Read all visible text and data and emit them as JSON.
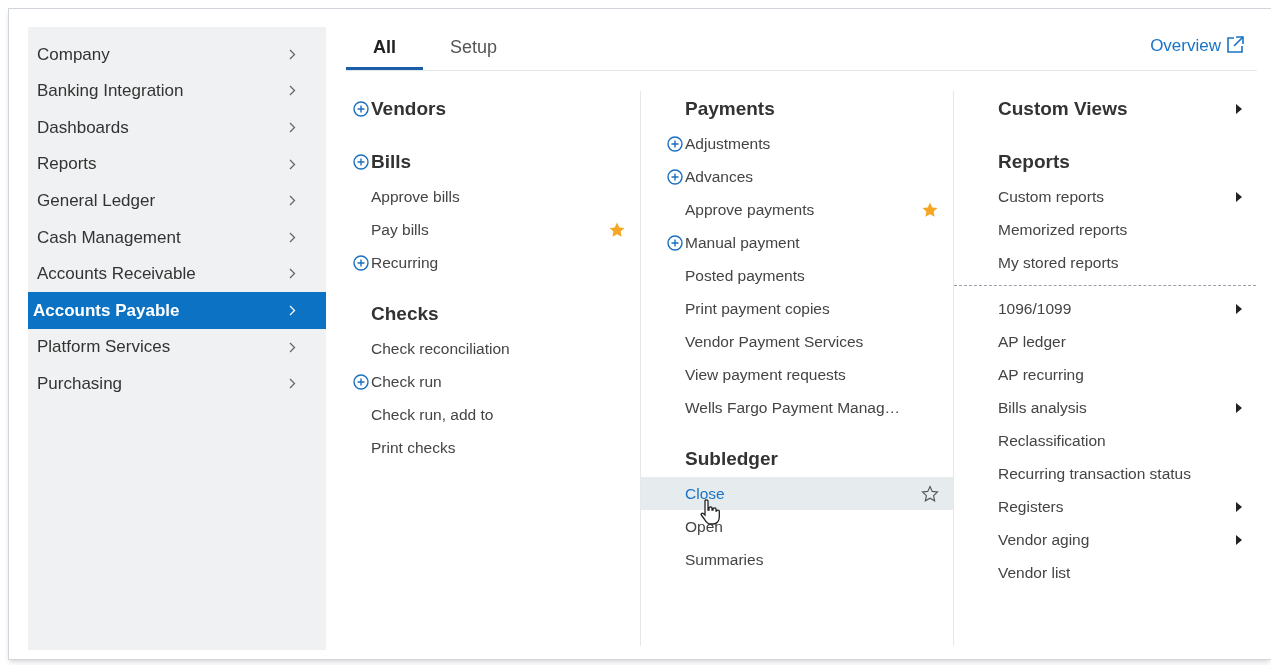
{
  "sidebar": {
    "items": [
      {
        "label": "Company",
        "selected": false
      },
      {
        "label": "Banking Integration",
        "selected": false
      },
      {
        "label": "Dashboards",
        "selected": false
      },
      {
        "label": "Reports",
        "selected": false
      },
      {
        "label": "General Ledger",
        "selected": false
      },
      {
        "label": "Cash Management",
        "selected": false
      },
      {
        "label": "Accounts Receivable",
        "selected": false
      },
      {
        "label": "Accounts Payable",
        "selected": true
      },
      {
        "label": "Platform Services",
        "selected": false
      },
      {
        "label": "Purchasing",
        "selected": false
      }
    ]
  },
  "tabs": [
    {
      "label": "All",
      "selected": true
    },
    {
      "label": "Setup",
      "selected": false
    }
  ],
  "overview_link": "Overview",
  "columns": [
    {
      "items": [
        {
          "kind": "heading",
          "label": "Vendors",
          "add": true
        },
        {
          "kind": "heading",
          "label": "Bills",
          "add": true
        },
        {
          "kind": "link",
          "label": "Approve bills"
        },
        {
          "kind": "link",
          "label": "Pay bills",
          "favorite": true
        },
        {
          "kind": "link",
          "label": "Recurring",
          "add": true
        },
        {
          "kind": "heading",
          "label": "Checks"
        },
        {
          "kind": "link",
          "label": "Check reconciliation"
        },
        {
          "kind": "link",
          "label": "Check run",
          "add": true
        },
        {
          "kind": "link",
          "label": "Check run, add to"
        },
        {
          "kind": "link",
          "label": "Print checks"
        }
      ]
    },
    {
      "items": [
        {
          "kind": "heading",
          "label": "Payments"
        },
        {
          "kind": "link",
          "label": "Adjustments",
          "add": true
        },
        {
          "kind": "link",
          "label": "Advances",
          "add": true
        },
        {
          "kind": "link",
          "label": "Approve payments",
          "favorite": true
        },
        {
          "kind": "link",
          "label": "Manual payment",
          "add": true
        },
        {
          "kind": "link",
          "label": "Posted payments"
        },
        {
          "kind": "link",
          "label": "Print payment copies"
        },
        {
          "kind": "link",
          "label": "Vendor Payment Services"
        },
        {
          "kind": "link",
          "label": "View payment requests"
        },
        {
          "kind": "link",
          "label": "Wells Fargo Payment Manag…"
        },
        {
          "kind": "heading",
          "label": "Subledger"
        },
        {
          "kind": "link",
          "label": "Close",
          "hovered": true
        },
        {
          "kind": "link",
          "label": "Open"
        },
        {
          "kind": "link",
          "label": "Summaries"
        }
      ]
    },
    {
      "items": [
        {
          "kind": "heading",
          "label": "Custom Views",
          "submenu": true
        },
        {
          "kind": "heading",
          "label": "Reports"
        },
        {
          "kind": "link",
          "label": "Custom reports",
          "submenu": true
        },
        {
          "kind": "link",
          "label": "Memorized reports"
        },
        {
          "kind": "link",
          "label": "My stored reports"
        },
        {
          "kind": "divider"
        },
        {
          "kind": "link",
          "label": "1096/1099",
          "submenu": true
        },
        {
          "kind": "link",
          "label": "AP ledger"
        },
        {
          "kind": "link",
          "label": "AP recurring"
        },
        {
          "kind": "link",
          "label": "Bills analysis",
          "submenu": true
        },
        {
          "kind": "link",
          "label": "Reclassification"
        },
        {
          "kind": "link",
          "label": "Recurring transaction status"
        },
        {
          "kind": "link",
          "label": "Registers",
          "submenu": true
        },
        {
          "kind": "link",
          "label": "Vendor aging",
          "submenu": true
        },
        {
          "kind": "link",
          "label": "Vendor list"
        }
      ]
    }
  ]
}
